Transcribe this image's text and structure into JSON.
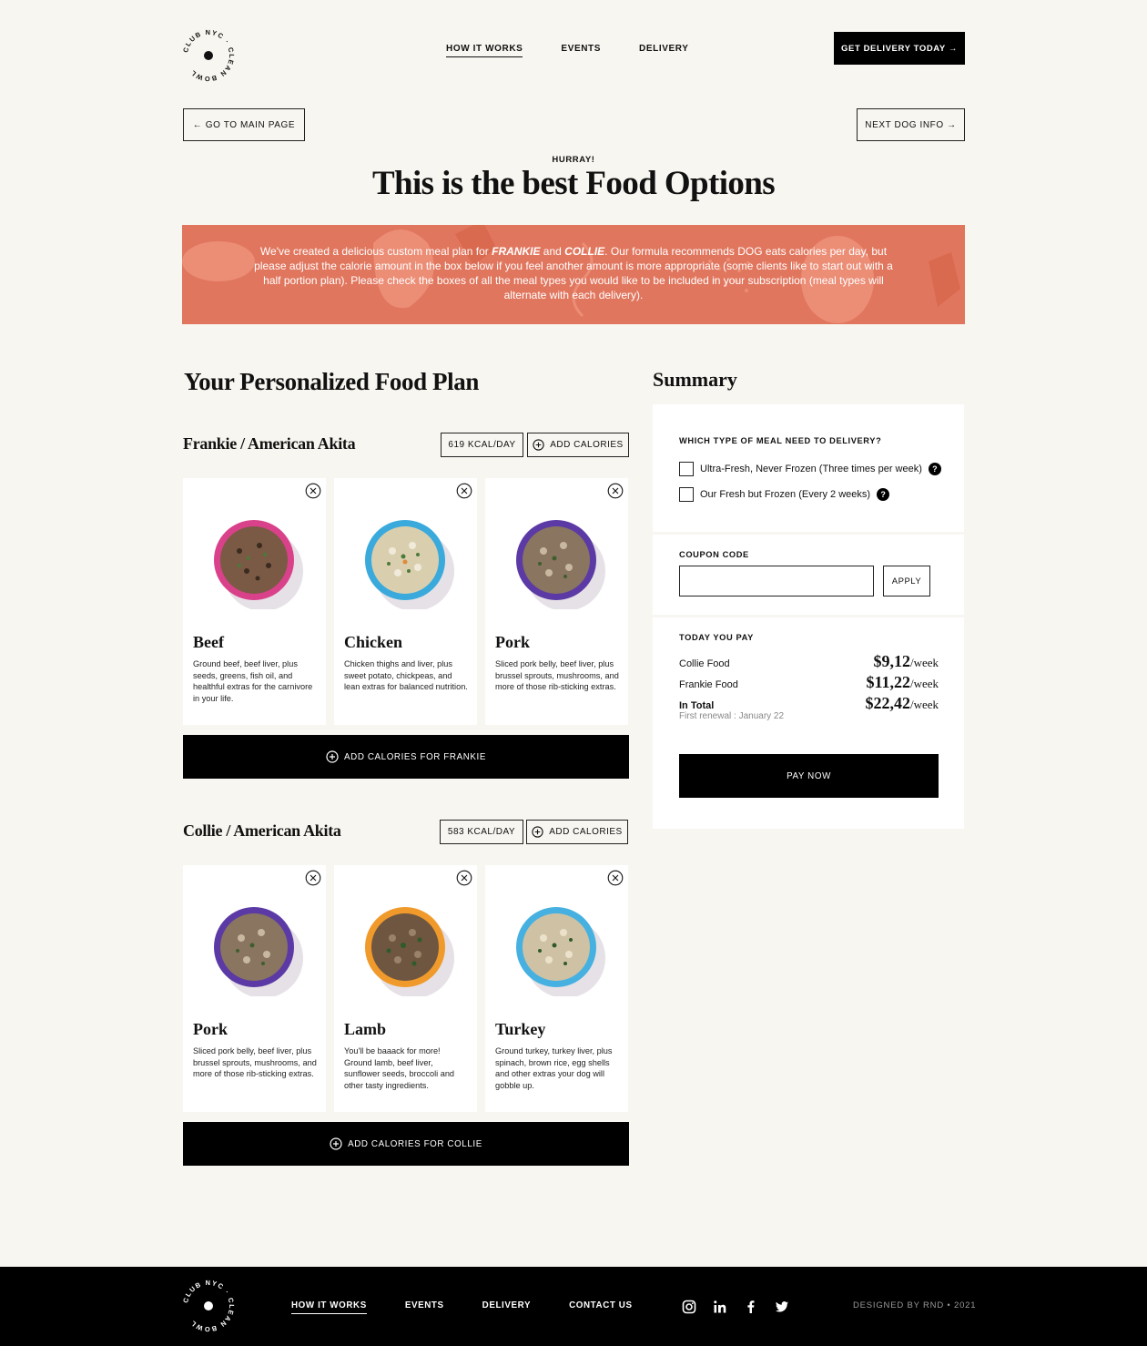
{
  "brand": {
    "logo_text": "CLUB NYC · CLEAN BOWL"
  },
  "nav": {
    "items": [
      "HOW IT WORKS",
      "EVENTS",
      "DELIVERY"
    ],
    "cta": "GET DELIVERY TODAY →"
  },
  "actions": {
    "back": "←  GO TO MAIN PAGE",
    "next": "NEXT DOG INFO →"
  },
  "hero": {
    "kicker": "HURRAY!",
    "title": "This is the best Food Options",
    "banner_pre": "We've created a delicious custom meal plan for ",
    "dog1": "FRANKIE",
    "and": " and ",
    "dog2": "COLLIE",
    "banner_post": ". Our formula recommends DOG eats calories per day, but please adjust the calorie amount in the box below if you feel another amount is more appropriate (some clients like to start out with a half portion plan). Please check the boxes of all the meal types you would like to be included in your subscription (meal types will alternate with each delivery)."
  },
  "plan": {
    "title": "Your Personalized Food Plan",
    "dogs": [
      {
        "name": "Frankie / American Akita",
        "kcal": "619 KCAL/DAY",
        "add_label": "ADD CALORIES",
        "bar_label": "ADD CALORIES FOR FRANKIE",
        "meals": [
          {
            "name": "Beef",
            "desc": "Ground beef, beef liver, plus seeds, greens, fish oil, and healthful extras for the carnivore in your life.",
            "bowl_color": "#d9418a"
          },
          {
            "name": "Chicken",
            "desc": "Chicken thighs and liver, plus sweet potato, chickpeas, and lean extras for balanced nutrition.",
            "bowl_color": "#3aa9dc"
          },
          {
            "name": "Pork",
            "desc": "Sliced pork belly, beef liver, plus brussel sprouts, mushrooms, and more of those rib-sticking extras.",
            "bowl_color": "#5b3aa5"
          }
        ]
      },
      {
        "name": "Collie / American Akita",
        "kcal": "583 KCAL/DAY",
        "add_label": "ADD CALORIES",
        "bar_label": "ADD CALORIES FOR COLLIE",
        "meals": [
          {
            "name": "Pork",
            "desc": "Sliced pork belly, beef liver, plus brussel sprouts, mushrooms, and more of those rib-sticking extras.",
            "bowl_color": "#5b3aa5"
          },
          {
            "name": "Lamb",
            "desc": "You'll be baaack for more! Ground lamb, beef liver, sunflower seeds, broccoli and other tasty ingredients.",
            "bowl_color": "#f09a2c"
          },
          {
            "name": "Turkey",
            "desc": "Ground turkey, turkey liver, plus spinach, brown rice, egg shells and other extras your dog will gobble up.",
            "bowl_color": "#46b1e0"
          }
        ]
      }
    ]
  },
  "summary": {
    "title": "Summary",
    "meal_question": "WHICH TYPE OF MEAL NEED TO DELIVERY?",
    "options": [
      "Ultra-Fresh, Never Frozen (Three times per week)",
      "Our Fresh but Frozen (Every 2 weeks)"
    ],
    "coupon_label": "COUPON CODE",
    "coupon_value": "",
    "apply": "APPLY",
    "pay_label": "TODAY YOU PAY",
    "lines": [
      {
        "label": "Collie Food",
        "price": "$9,12",
        "unit": "/week"
      },
      {
        "label": "Frankie Food",
        "price": "$11,22",
        "unit": "/week"
      },
      {
        "label": "In Total",
        "price": "$22,42",
        "unit": "/week"
      }
    ],
    "renewal": "First renewal : January 22",
    "pay_now": "PAY NOW"
  },
  "footer": {
    "nav": [
      "HOW IT WORKS",
      "EVENTS",
      "DELIVERY",
      "CONTACT US"
    ],
    "social": [
      "instagram-icon",
      "linkedin-icon",
      "facebook-icon",
      "twitter-icon"
    ],
    "credit": "DESIGNED BY RND  •  2021"
  },
  "colors": {
    "banner": "#e1765e",
    "background": "#f8f6f1"
  }
}
